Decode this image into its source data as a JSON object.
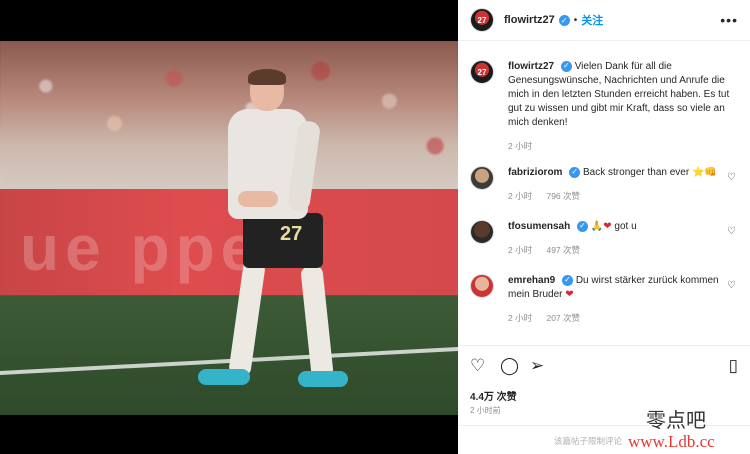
{
  "post": {
    "author": "flowirtz27",
    "avatar_text": "27",
    "follow_label": "关注",
    "more_icon": "more-horizontal-icon",
    "caption": "Vielen Dank für all die Genesungswünsche, Nachrichten und Anrufe die mich in den letzten Stunden erreicht haben. Es tut gut zu wissen und gibt mir Kraft, dass so viele an mich denken!",
    "caption_time": "2 小时",
    "photo": {
      "ad_text": "ue  ppe",
      "shirt_number": "27"
    }
  },
  "comments": [
    {
      "user": "fabriziorom",
      "text": "Back stronger than ever",
      "emoji": "⭐👊",
      "time": "2 小时",
      "likes": "796 次赞"
    },
    {
      "user": "tfosumensah",
      "text": "got u",
      "emoji": "🙏❤",
      "time": "2 小时",
      "likes": "497 次赞"
    },
    {
      "user": "emrehan9",
      "text": "Du wirst stärker zurück kommen mein Bruder",
      "emoji": "❤",
      "time": "2 小时",
      "likes": "207 次赞"
    }
  ],
  "actions": {
    "like_icon": "heart-icon",
    "comment_icon": "comment-icon",
    "share_icon": "send-icon",
    "save_icon": "bookmark-icon"
  },
  "stats": {
    "likes": "4.4万 次赞",
    "time": "2 小时前"
  },
  "footer": {
    "comment_limited": "该篇帖子限制评论"
  },
  "watermark": {
    "title": "零点吧",
    "url": "www.Ldb.cc"
  },
  "colors": {
    "accent": "#0095f6",
    "verified": "#3897f0",
    "heart_red": "#d7263d"
  }
}
